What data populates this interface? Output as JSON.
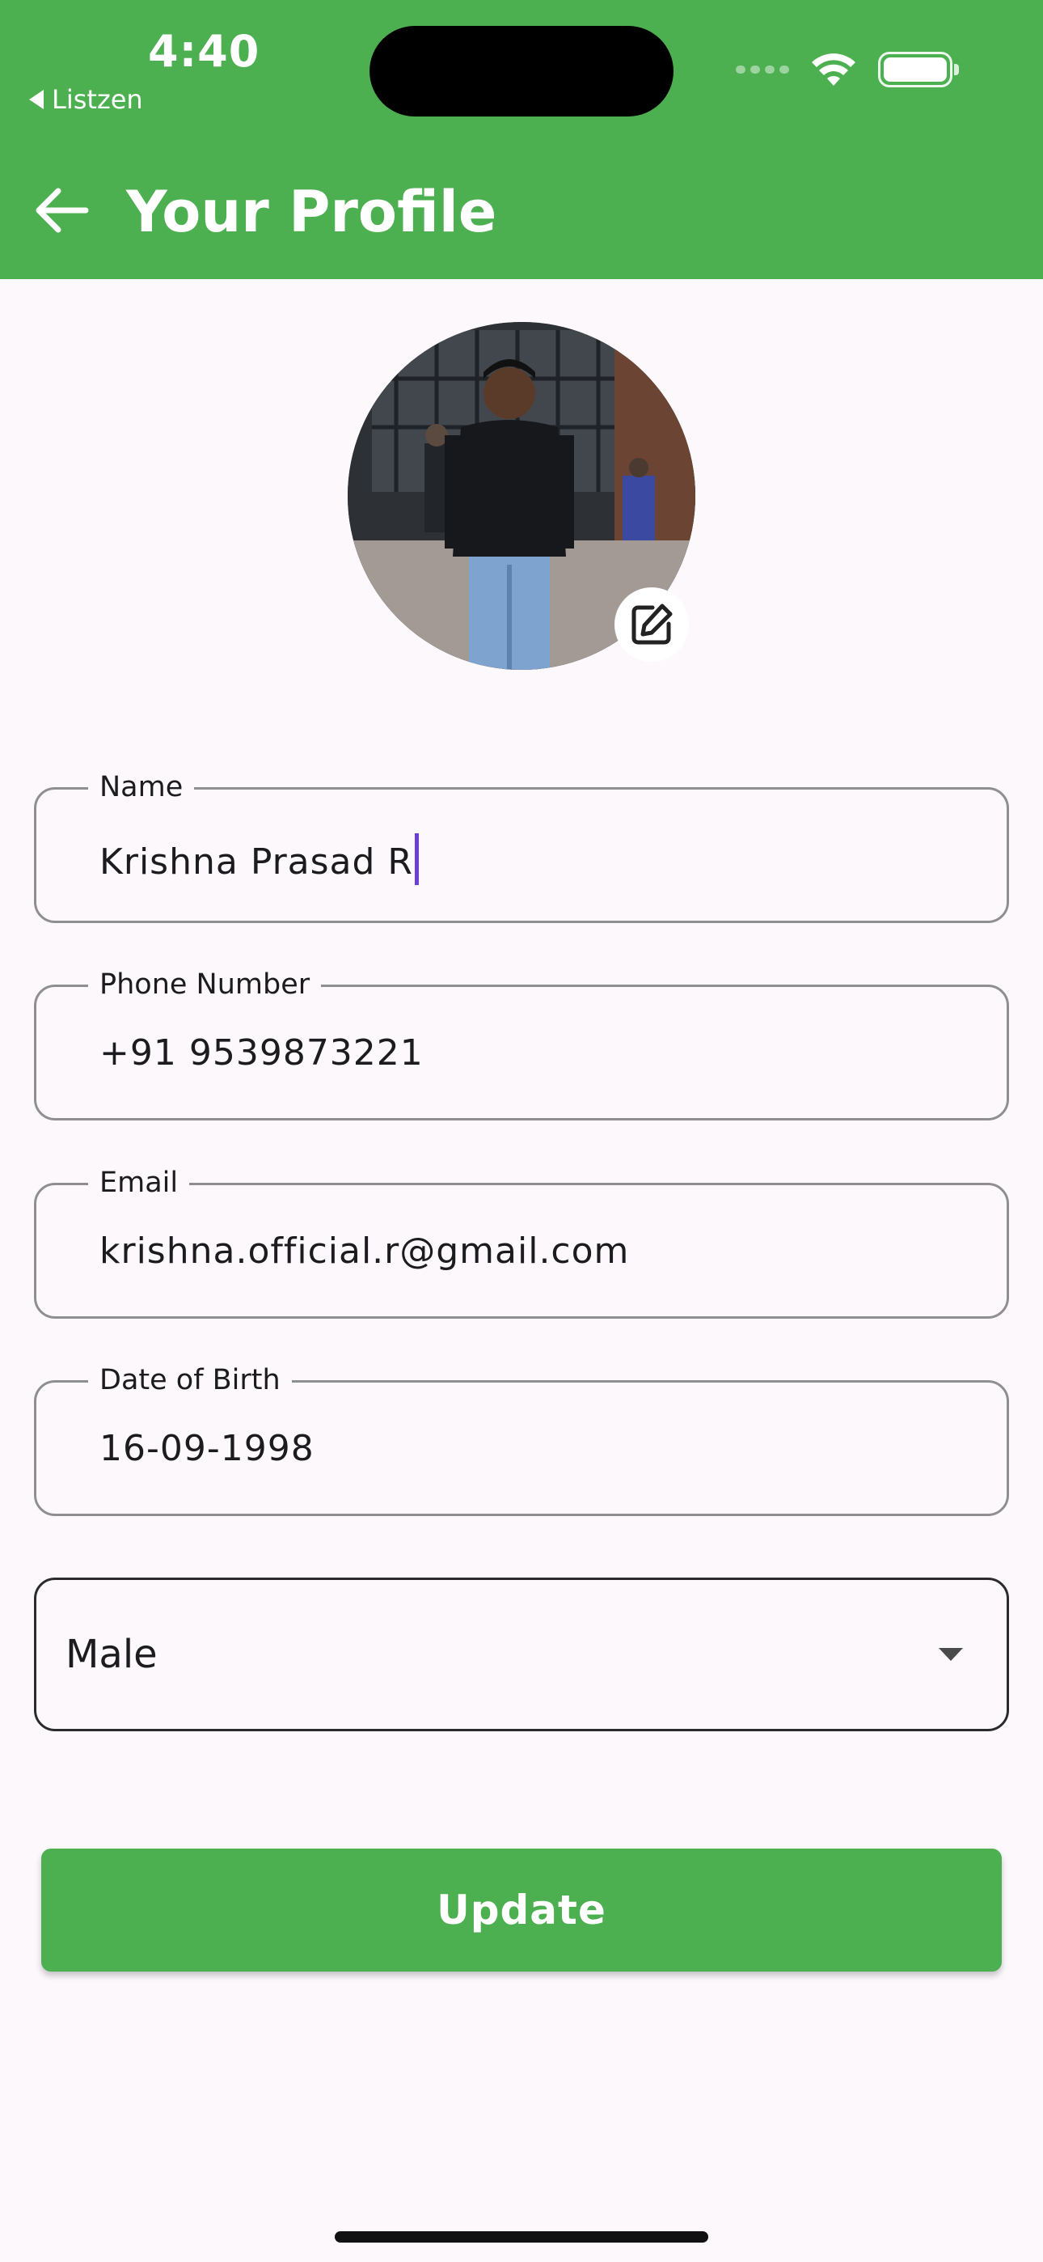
{
  "status_bar": {
    "time": "4:40",
    "back_app": "Listzen"
  },
  "app_bar": {
    "title": "Your Profile"
  },
  "profile": {
    "avatar_alt": "Profile photo"
  },
  "form": {
    "name": {
      "label": "Name",
      "value": "Krishna Prasad R"
    },
    "phone": {
      "label": "Phone Number",
      "value": "+91 9539873221"
    },
    "email": {
      "label": "Email",
      "value": "krishna.official.r@gmail.com"
    },
    "dob": {
      "label": "Date of Birth",
      "value": "16-09-1998"
    },
    "gender": {
      "selected": "Male"
    }
  },
  "actions": {
    "update_label": "Update"
  },
  "colors": {
    "accent": "#4caf50",
    "background": "#fdf8fc",
    "caret": "#6b3fd6"
  }
}
